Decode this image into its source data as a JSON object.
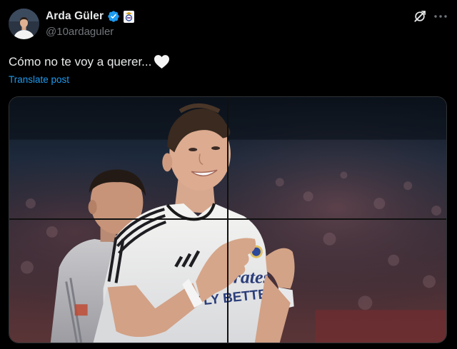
{
  "author": {
    "display_name": "Arda Güler",
    "handle": "@10ardaguler",
    "verified_icon": "verified-badge-icon",
    "affiliation_icon": "club-crest-icon"
  },
  "post": {
    "text": "Cómo no te voy a querer...",
    "emoji": "white-heart-icon",
    "translate_label": "Translate post"
  },
  "media": {
    "kind": "photo",
    "shirt_sponsor_lines": [
      "Emirates",
      "FLY BETTER"
    ],
    "subject": "player in white kit, hands on chest, smiling; teammate in background"
  },
  "actions": {
    "grok_icon": "grok-icon",
    "more_icon": "more-options-icon"
  },
  "colors": {
    "background": "#000000",
    "text_primary": "#e7e9ea",
    "text_secondary": "#71767b",
    "link": "#1d9bf0",
    "verified": "#1d9bf0"
  }
}
